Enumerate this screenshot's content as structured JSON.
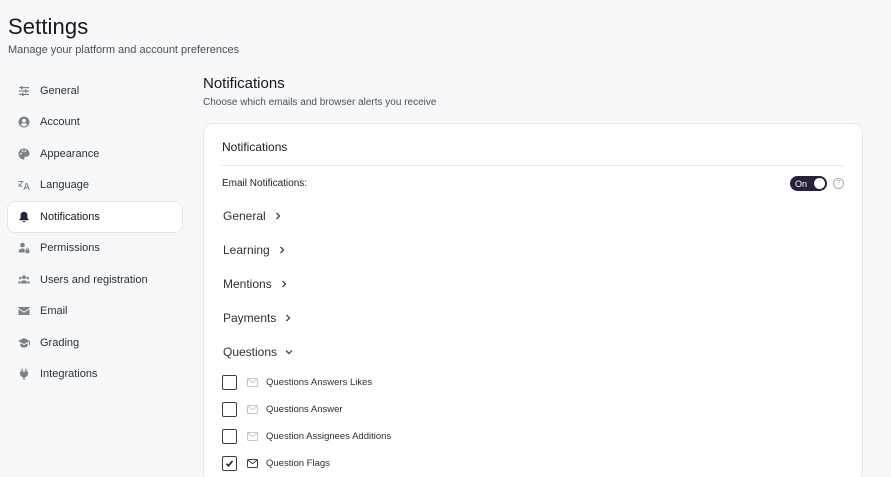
{
  "header": {
    "title": "Settings",
    "subtitle": "Manage your platform and account preferences"
  },
  "sidebar": {
    "items": [
      {
        "label": "General",
        "icon": "sliders-icon"
      },
      {
        "label": "Account",
        "icon": "user-circle-icon"
      },
      {
        "label": "Appearance",
        "icon": "palette-icon"
      },
      {
        "label": "Language",
        "icon": "translate-icon"
      },
      {
        "label": "Notifications",
        "icon": "bell-icon",
        "active": true
      },
      {
        "label": "Permissions",
        "icon": "user-lock-icon"
      },
      {
        "label": "Users and registration",
        "icon": "users-icon"
      },
      {
        "label": "Email",
        "icon": "envelope-icon"
      },
      {
        "label": "Grading",
        "icon": "graduation-cap-icon"
      },
      {
        "label": "Integrations",
        "icon": "plug-icon"
      }
    ]
  },
  "main": {
    "title": "Notifications",
    "subtitle": "Choose which emails and browser alerts you receive",
    "card": {
      "title": "Notifications",
      "email_label": "Email Notifications:",
      "toggle_label": "On",
      "help_glyph": "?",
      "groups": [
        {
          "label": "General",
          "expanded": false
        },
        {
          "label": "Learning",
          "expanded": false
        },
        {
          "label": "Mentions",
          "expanded": false
        },
        {
          "label": "Payments",
          "expanded": false
        },
        {
          "label": "Questions",
          "expanded": true
        }
      ],
      "question_items": [
        {
          "label": "Questions Answers Likes",
          "checked": false
        },
        {
          "label": "Questions Answer",
          "checked": false
        },
        {
          "label": "Question Assignees Additions",
          "checked": false
        },
        {
          "label": "Question Flags",
          "checked": true
        }
      ]
    }
  },
  "colors": {
    "toggle_on": "#2a1f3d",
    "page_bg": "#f7f8fa"
  }
}
